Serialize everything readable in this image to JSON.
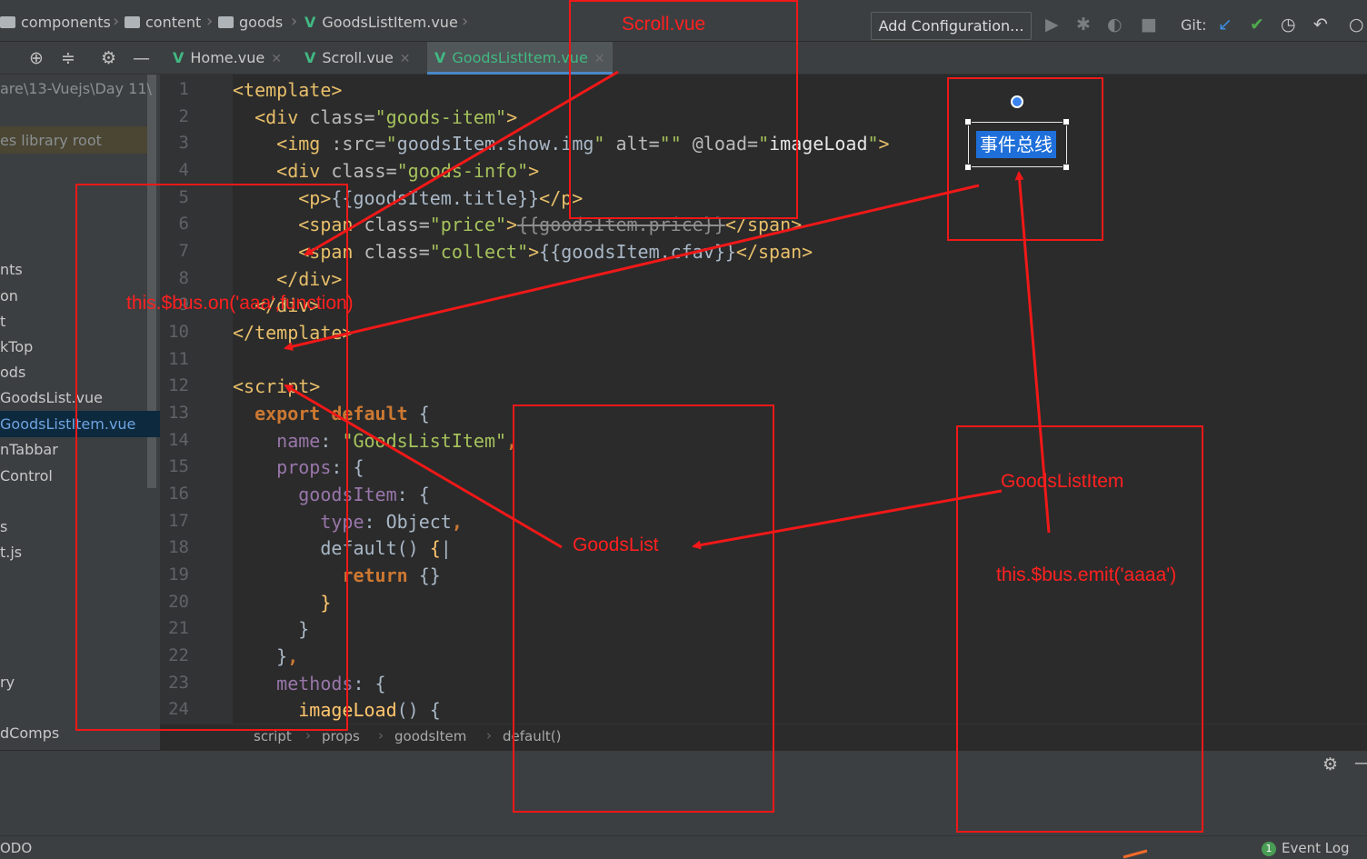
{
  "breadcrumb": {
    "items": [
      {
        "label": "components",
        "type": "folder"
      },
      {
        "label": "content",
        "type": "folder"
      },
      {
        "label": "goods",
        "type": "folder"
      },
      {
        "label": "GoodsListItem.vue",
        "type": "vue-file"
      }
    ]
  },
  "toolbar": {
    "add_config_label": "Add Configuration...",
    "git_label": "Git:",
    "icons": [
      "run-icon",
      "debug-icon",
      "coverage-icon",
      "stop-icon",
      "git-update-icon",
      "git-commit-icon",
      "history-icon",
      "rollback-icon"
    ]
  },
  "tabs": [
    {
      "label": "Home.vue",
      "active": false
    },
    {
      "label": "Scroll.vue",
      "active": false
    },
    {
      "label": "GoodsListItem.vue",
      "active": true
    }
  ],
  "project_tree": {
    "path_label": "are\\13-Vuejs\\Day 11\\",
    "root_label": "es library root",
    "items": [
      "nts",
      "on",
      "t",
      "kTop",
      "ods",
      "GoodsList.vue",
      "GoodsListItem.vue",
      "nTabbar",
      "Control",
      "s",
      "t.js",
      "ry",
      "dComps"
    ],
    "selected": "GoodsListItem.vue"
  },
  "editor": {
    "line_numbers": [
      "1",
      "2",
      "3",
      "4",
      "5",
      "6",
      "7",
      "8",
      "9",
      "10",
      "11",
      "12",
      "13",
      "14",
      "15",
      "16",
      "17",
      "18",
      "19",
      "20",
      "21",
      "22",
      "23",
      "24"
    ],
    "code_breadcrumb": [
      "script",
      "props",
      "goodsItem",
      "default()"
    ]
  },
  "status_bar": {
    "todo_label": "ODO",
    "event_log_label": "Event Log",
    "event_log_count": "1"
  },
  "annotations": {
    "scroll_label": "Scroll.vue",
    "bus_on_label": "this.$bus.on('aaa',function)",
    "goods_list_label": "GoodsList",
    "goods_list_item_label": "GoodsListItem",
    "bus_emit_label": "this.$bus.emit('aaaa')",
    "event_bus_label": "事件总线",
    "color": "#f01818"
  }
}
